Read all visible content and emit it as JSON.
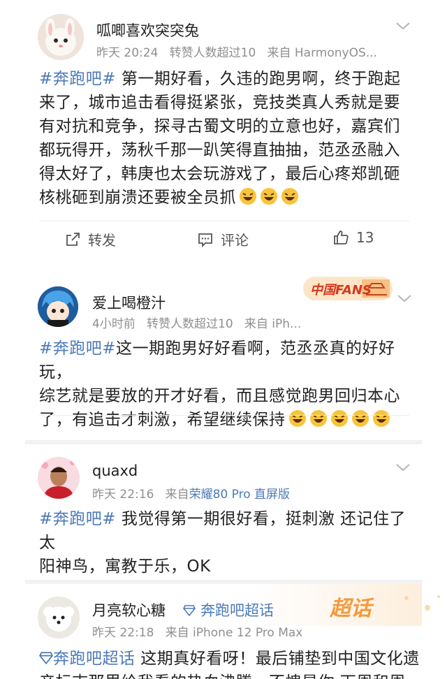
{
  "post1": {
    "username": "呱唧喜欢突突兔",
    "time": "昨天 20:24",
    "repost_info": "转赞人数超过10",
    "source": "来自 HarmonyOS...",
    "topic": "#奔跑吧#",
    "lines": [
      " 第一期好看，久违的跑男啊，终于跑起",
      "来了，城市追击看得挺紧张，竞技类真人秀就是要",
      "有对抗和竞争，探寻古蜀文明的立意也好，嘉宾们",
      "都玩得开，荡秋千那一趴笑得直抽抽，范丞丞融入",
      "得太好了，韩庚也太会玩游戏了，最后心疼郑凯砸",
      "核桃砸到崩溃还要被全员抓"
    ],
    "actions": {
      "repost_label": "转发",
      "comment_label": "评论",
      "like_count": "13"
    }
  },
  "post2": {
    "username": "爱上喝橙汁",
    "badge_text": "中国FANS",
    "time": "4小时前",
    "repost_info": "转赞人数超过10",
    "source": "来自 iPh...",
    "topic": "#奔跑吧#",
    "lines": [
      "这一期跑男好好看啊，范丞丞真的好好玩，",
      "综艺就是要放的开才好看，而且感觉跑男回归本心",
      "了，有追击才刺激，希望继续保持"
    ]
  },
  "post3": {
    "username": "quaxd",
    "time": "昨天 22:16",
    "source_prefix": "来自",
    "source_device": "荣耀80 Pro 直屏版",
    "topic": "#奔跑吧#",
    "lines": [
      " 我觉得第一期很好看，挺刺激 还记住了太",
      "阳神鸟，寓教于乐，OK"
    ]
  },
  "post4": {
    "username": "月亮软心糖",
    "supertopic": "奔跑吧超话",
    "badge_text": "超话",
    "time": "昨天 22:18",
    "source": "来自 iPhone 12 Pro Max",
    "topic": "奔跑吧超话",
    "lines": [
      " 这期真好看呀！最后铺垫到中国文化遗",
      "产标志那里给我看的热血沸腾，不愧是你 下周和周"
    ]
  },
  "colors": {
    "link_blue": "#4c7ab8",
    "meta_gray": "#8f8f8f",
    "separator": "#f2f2f2"
  }
}
